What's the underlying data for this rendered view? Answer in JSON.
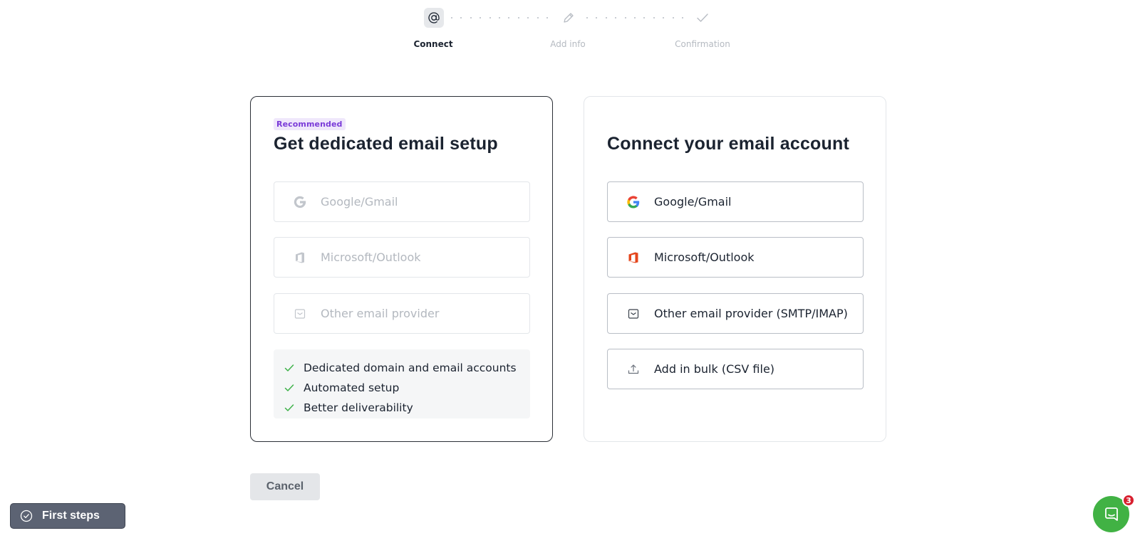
{
  "stepper": {
    "steps": [
      {
        "label": "Connect",
        "icon": "at-sign-icon",
        "active": true
      },
      {
        "label": "Add info",
        "icon": "pencil-icon",
        "active": false
      },
      {
        "label": "Confirmation",
        "icon": "check-icon",
        "active": false
      }
    ]
  },
  "left_card": {
    "badge": "Recommended",
    "title": "Get dedicated email setup",
    "options": [
      {
        "label": "Google/Gmail",
        "icon": "google-icon"
      },
      {
        "label": "Microsoft/Outlook",
        "icon": "office-icon"
      },
      {
        "label": "Other email provider",
        "icon": "mail-icon"
      }
    ],
    "benefits": [
      "Dedicated domain and email accounts",
      "Automated setup",
      "Better deliverability"
    ]
  },
  "right_card": {
    "title": "Connect your email account",
    "options": [
      {
        "label": "Google/Gmail",
        "icon": "google-icon"
      },
      {
        "label": "Microsoft/Outlook",
        "icon": "office-icon"
      },
      {
        "label": "Other email provider (SMTP/IMAP)",
        "icon": "mail-icon"
      },
      {
        "label": "Add in bulk (CSV file)",
        "icon": "upload-icon"
      }
    ]
  },
  "cancel_label": "Cancel",
  "first_steps": {
    "label": "First steps",
    "icon": "check-circle-icon"
  },
  "chat": {
    "icon": "chat-icon",
    "badge_count": "3"
  },
  "colors": {
    "active_border": "#2b2f36",
    "badge_bg": "#efe7fb",
    "badge_text": "#7a3bd8",
    "check_green": "#3fb24a",
    "chat_green": "#41b244",
    "notification_red": "#d8202f",
    "first_steps_bg": "#5c6373"
  }
}
